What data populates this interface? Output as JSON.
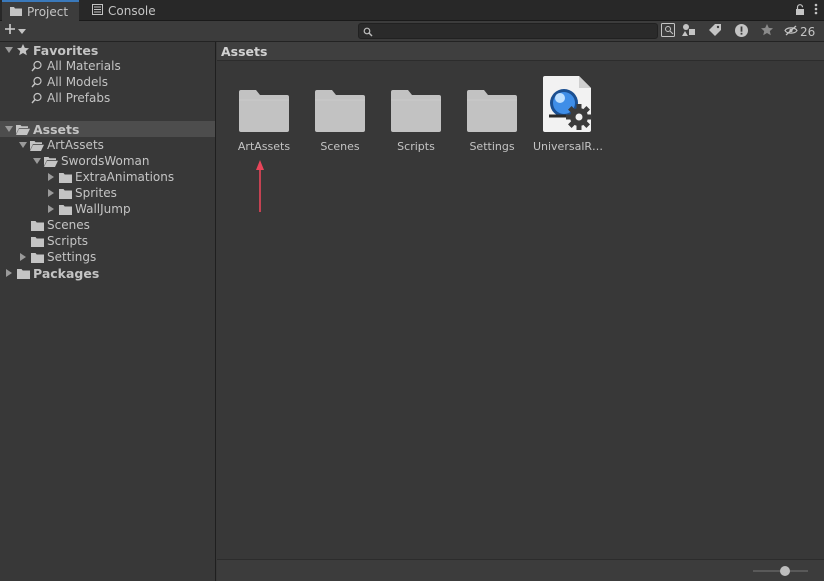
{
  "tabs": [
    {
      "label": "Project",
      "icon": "folder-icon",
      "active": true
    },
    {
      "label": "Console",
      "icon": "console-icon",
      "active": false
    }
  ],
  "toolbar": {
    "search_placeholder": "",
    "hidden_count": "26"
  },
  "tree": {
    "favorites": {
      "label": "Favorites",
      "items": [
        "All Materials",
        "All Models",
        "All Prefabs"
      ]
    },
    "assets": {
      "label": "Assets",
      "artassets": "ArtAssets",
      "swordswoman": "SwordsWoman",
      "sw_children": [
        "ExtraAnimations",
        "Sprites",
        "WallJump"
      ],
      "scenes": "Scenes",
      "scripts": "Scripts",
      "settings": "Settings"
    },
    "packages": "Packages"
  },
  "content": {
    "breadcrumb": "Assets",
    "items": [
      {
        "label": "ArtAssets",
        "type": "folder"
      },
      {
        "label": "Scenes",
        "type": "folder"
      },
      {
        "label": "Scripts",
        "type": "folder"
      },
      {
        "label": "Settings",
        "type": "folder"
      },
      {
        "label": "UniversalR…",
        "type": "render-pipeline-asset"
      }
    ]
  },
  "colors": {
    "background": "#383838",
    "tab_accent": "#3a79bb",
    "folder": "#c2c2c2",
    "arrow_annotation": "#e8455a"
  }
}
